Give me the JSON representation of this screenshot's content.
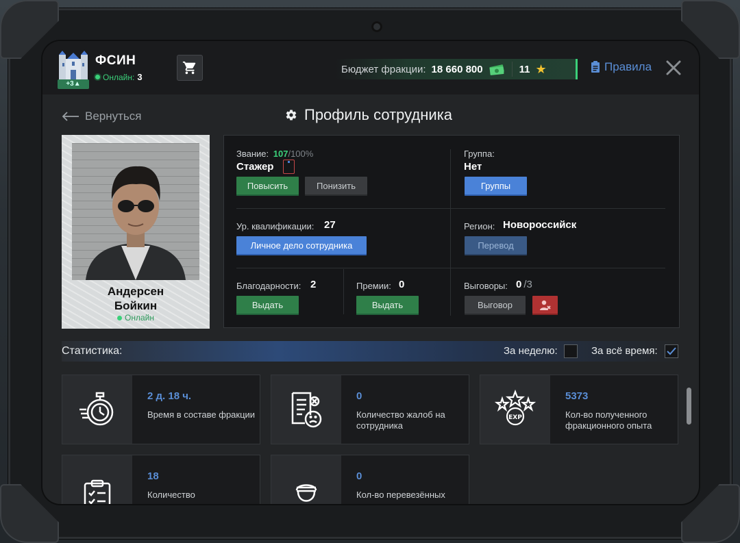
{
  "header": {
    "faction_name": "ФСИН",
    "badge": "+3",
    "online_label": "Онлайн:",
    "online_count": "3",
    "budget_label": "Бюджет фракции:",
    "budget_value": "18 660 800",
    "stars_value": "11",
    "rules_label": "Правила"
  },
  "nav": {
    "back_label": "Вернуться",
    "page_title": "Профиль сотрудника"
  },
  "employee": {
    "first_name": "Андерсен",
    "last_name": "Бойкин",
    "status": "Онлайн"
  },
  "info": {
    "rank_label": "Звание:",
    "rank_progress": "107",
    "rank_progress_max": "/100%",
    "rank_value": "Стажер",
    "promote_button": "Повысить",
    "demote_button": "Понизить",
    "group_label": "Группа:",
    "group_value": "Нет",
    "groups_button": "Группы",
    "qual_label": "Ур. квалификации:",
    "qual_value": "27",
    "personal_file_button": "Личное дело сотрудника",
    "region_label": "Регион:",
    "region_value": "Новороссийск",
    "transfer_button": "Перевод",
    "thanks_label": "Благодарности:",
    "thanks_value": "2",
    "thanks_button": "Выдать",
    "bonus_label": "Премии:",
    "bonus_value": "0",
    "bonus_button": "Выдать",
    "reprimand_label": "Выговоры:",
    "reprimand_value": "0",
    "reprimand_max": "/3",
    "reprimand_button": "Выговор"
  },
  "stats": {
    "title": "Статистика:",
    "week_label": "За неделю:",
    "alltime_label": "За всё время:",
    "cards": [
      {
        "value": "2 д. 18 ч.",
        "desc": "Время в составе фракции"
      },
      {
        "value": "0",
        "desc": "Количество жалоб на сотрудника"
      },
      {
        "value": "5373",
        "desc": "Кол-во полученного фракционного опыта"
      },
      {
        "value": "18",
        "desc": "Количество"
      },
      {
        "value": "0",
        "desc": "Кол-во перевезённых"
      }
    ]
  },
  "colors": {
    "accent_blue": "#5a8ed6",
    "online_green": "#3bd07a",
    "button_green": "#2f7f49",
    "button_red": "#b03232"
  }
}
